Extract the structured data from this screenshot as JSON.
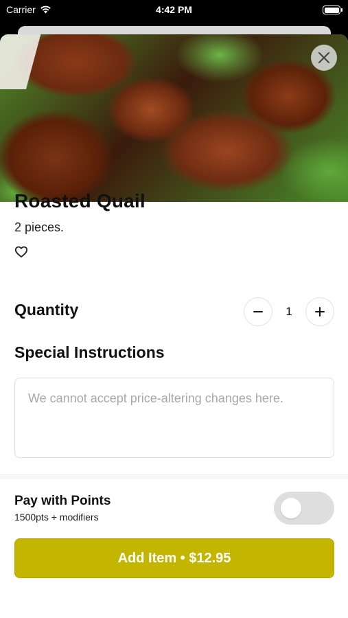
{
  "status_bar": {
    "carrier": "Carrier",
    "time": "4:42 PM"
  },
  "item": {
    "name": "Roasted Quail",
    "description": "2 pieces."
  },
  "quantity": {
    "label": "Quantity",
    "value": "1"
  },
  "special_instructions": {
    "label": "Special Instructions",
    "placeholder": "We cannot accept price-altering changes here.",
    "value": ""
  },
  "points": {
    "title": "Pay with Points",
    "subtitle": "1500pts + modifiers",
    "enabled": false
  },
  "add_button": {
    "label": "Add Item • $12.95"
  },
  "colors": {
    "accent": "#c4b600",
    "toggle_off": "#dedede"
  },
  "icons": [
    "wifi-icon",
    "battery-icon",
    "close-icon",
    "heart-icon",
    "minus-icon",
    "plus-icon"
  ]
}
